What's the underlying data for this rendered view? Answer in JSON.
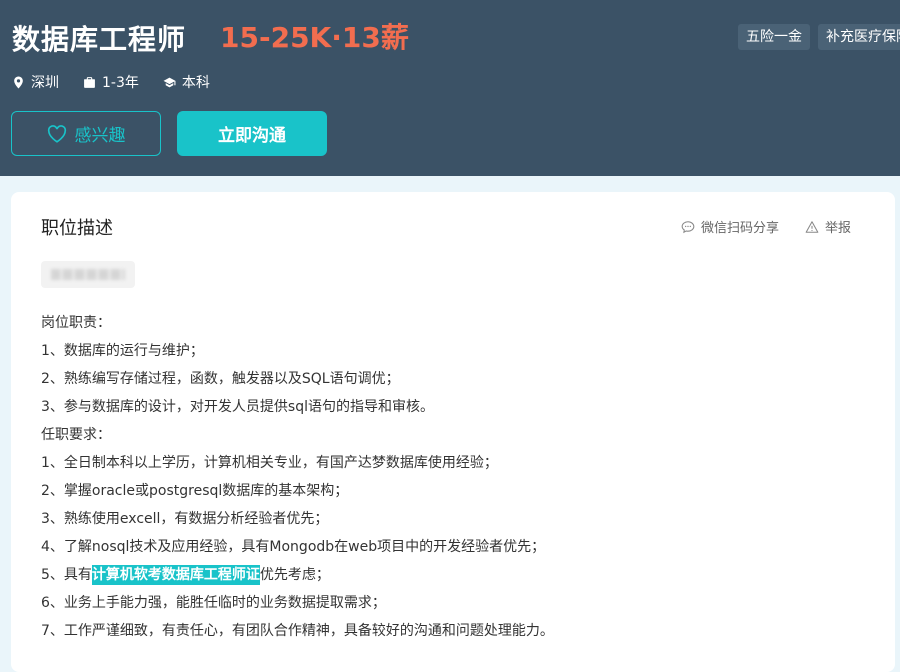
{
  "job": {
    "title": "数据库工程师",
    "salary": "15-25K·13薪",
    "benefits": [
      "五险一金",
      "补充医疗保险"
    ],
    "location": "深圳",
    "experience": "1-3年",
    "education": "本科"
  },
  "buttons": {
    "interest": "感兴趣",
    "chat": "立即沟通"
  },
  "description": {
    "title": "职位描述",
    "share_label": "微信扫码分享",
    "report_label": "举报",
    "lines": [
      "岗位职责：",
      "1、数据库的运行与维护；",
      "2、熟练编写存储过程，函数，触发器以及SQL语句调优；",
      "3、参与数据库的设计，对开发人员提供sql语句的指导和审核。",
      "任职要求：",
      "1、全日制本科以上学历，计算机相关专业，有国产达梦数据库使用经验；",
      "2、掌握oracle或postgresql数据库的基本架构；",
      "3、熟练使用excell，有数据分析经验者优先；",
      "4、了解nosql技术及应用经验，具有Mongodb在web项目中的开发经验者优先；"
    ],
    "line5_prefix": "5、具有",
    "line5_highlight": "计算机软考数据库工程师证",
    "line5_suffix": "优先考虑；",
    "lines_after": [
      "6、业务上手能力强，能胜任临时的业务数据提取需求；",
      "7、工作严谨细致，有责任心，有团队合作精神，具备较好的沟通和问题处理能力。"
    ]
  },
  "colors": {
    "header_bg": "#3b5266",
    "accent": "#19c3c9",
    "salary": "#f26d4f"
  }
}
